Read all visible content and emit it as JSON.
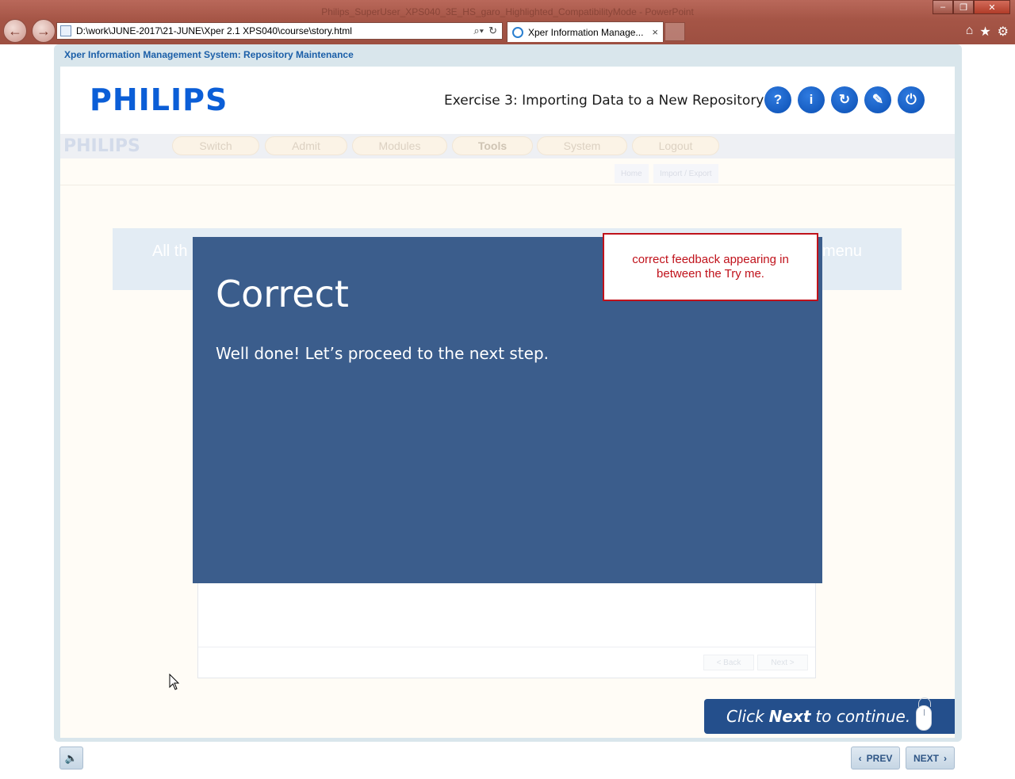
{
  "browser": {
    "window_title": "Philips_SuperUser_XPS040_3E_HS_garo_Highlighted_CompatibilityMode - PowerPoint",
    "url": "D:\\work\\JUNE-2017\\21-JUNE\\Xper 2.1 XPS040\\course\\story.html",
    "tab_label": "Xper Information Manage...",
    "tab_close": "×",
    "back_icon": "back-arrow-icon",
    "forward_icon": "forward-arrow-icon"
  },
  "course": {
    "frame_title": "Xper Information Management System: Repository Maintenance",
    "logo": "PHILIPS",
    "exercise_title": "Exercise 3: Importing Data to a New Repository",
    "header_buttons": [
      {
        "glyph": "?",
        "icon": "help-icon"
      },
      {
        "glyph": "i",
        "icon": "info-icon"
      },
      {
        "glyph": "↻",
        "icon": "replay-icon"
      },
      {
        "glyph": "✎",
        "icon": "notes-icon"
      },
      {
        "glyph": "⏻",
        "icon": "exit-icon"
      }
    ]
  },
  "app": {
    "logo": "PHILIPS",
    "menus": [
      "Switch",
      "Admit",
      "Modules",
      "Tools",
      "System",
      "Logout"
    ],
    "crumb_home": "Home",
    "crumb_page": "Import / Export",
    "banner_left": "All th",
    "banner_right": "menu",
    "wizard_back": "< Back",
    "wizard_next": "Next >"
  },
  "feedback": {
    "title": "Correct",
    "message": "Well done! Let’s proceed to the next step."
  },
  "note": {
    "text": "correct feedback appearing in between the Try me."
  },
  "footer": {
    "continue_pre": "Click",
    "continue_bold": "Next",
    "continue_post": "to continue.",
    "prev_label": "PREV",
    "next_label": "NEXT"
  },
  "colors": {
    "modal_bg": "#3b5d8c",
    "note_border": "#c0121b",
    "brand_blue": "#0b5ed7",
    "continue_bg": "#244f8c"
  }
}
